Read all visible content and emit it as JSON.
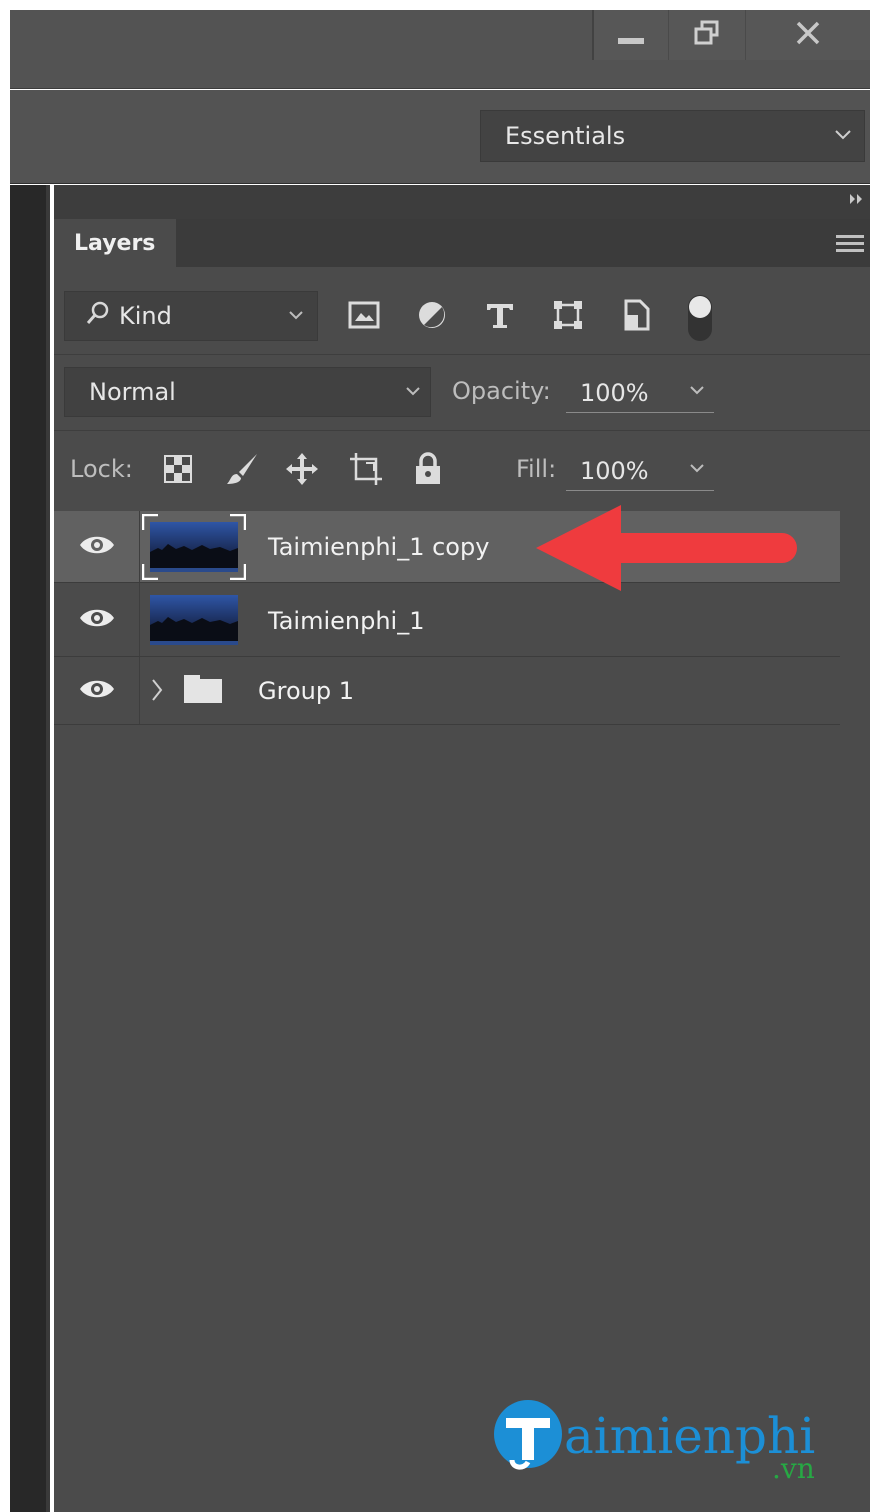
{
  "window": {
    "controls": [
      {
        "icon": "minimize-icon"
      },
      {
        "icon": "restore-icon"
      },
      {
        "icon": "close-icon"
      }
    ]
  },
  "options_bar": {
    "workspace": "Essentials"
  },
  "layers_panel": {
    "tab_label": "Layers",
    "filter": {
      "kind_label": "Kind",
      "filter_icons": [
        "pixel-layer-filter-icon",
        "adjustment-layer-filter-icon",
        "type-layer-filter-icon",
        "shape-layer-filter-icon",
        "smart-object-filter-icon"
      ]
    },
    "blend_mode": "Normal",
    "opacity_label": "Opacity:",
    "opacity_value": "100%",
    "lock_label": "Lock:",
    "lock_icons": [
      "lock-transparent-pixels-icon",
      "lock-image-pixels-icon",
      "lock-position-icon",
      "lock-artboard-icon",
      "lock-all-icon"
    ],
    "fill_label": "Fill:",
    "fill_value": "100%",
    "layers": [
      {
        "name": "Taimienphi_1 copy",
        "type": "image",
        "selected": true,
        "visible": true
      },
      {
        "name": "Taimienphi_1",
        "type": "image",
        "selected": false,
        "visible": true
      },
      {
        "name": "Group 1",
        "type": "group",
        "selected": false,
        "visible": true
      }
    ]
  },
  "annotation": {
    "arrow_color": "#ef3b3e"
  },
  "watermark": {
    "brand": "Taimienphi",
    "suffix": ".vn"
  },
  "colors": {
    "panel_bg": "#4b4b4b",
    "selected_row": "#616161",
    "titlebar": "#535353"
  }
}
